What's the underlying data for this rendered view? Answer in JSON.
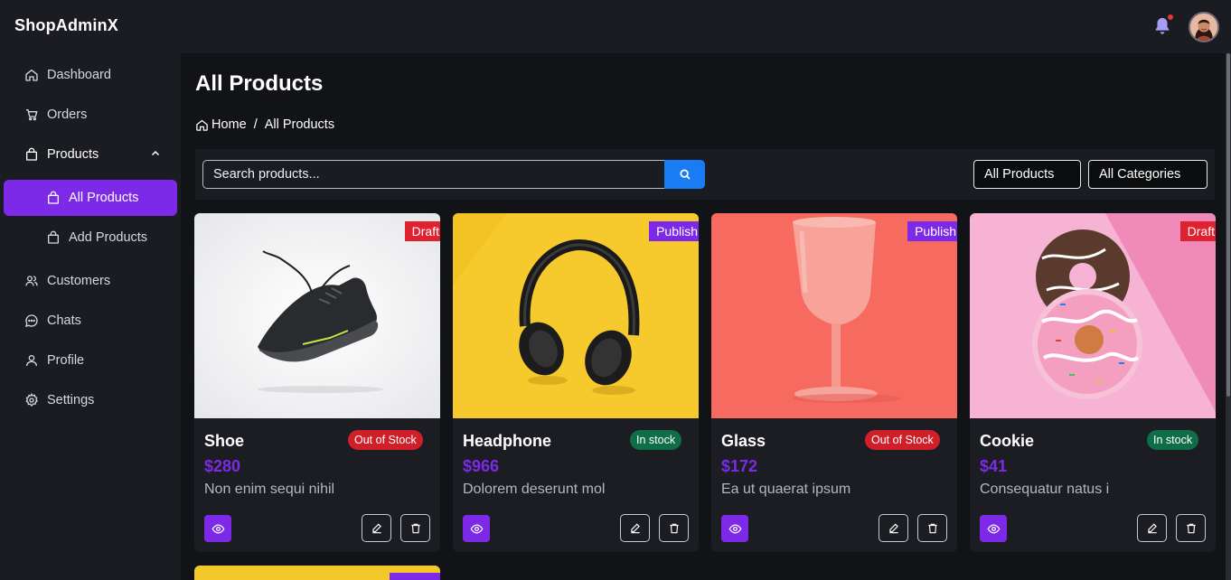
{
  "app": {
    "brand": "ShopAdminX"
  },
  "sidebar": {
    "items": [
      {
        "label": "Dashboard",
        "icon": "home-icon"
      },
      {
        "label": "Orders",
        "icon": "cart-icon"
      },
      {
        "label": "Products",
        "icon": "bag-icon",
        "expanded": true
      },
      {
        "label": "All Products",
        "icon": "bag-icon",
        "active": true
      },
      {
        "label": "Add Products",
        "icon": "bag-icon"
      },
      {
        "label": "Customers",
        "icon": "users-icon"
      },
      {
        "label": "Chats",
        "icon": "chat-icon"
      },
      {
        "label": "Profile",
        "icon": "user-icon"
      },
      {
        "label": "Settings",
        "icon": "gear-icon"
      }
    ]
  },
  "page": {
    "title": "All Products",
    "breadcrumb": {
      "home": "Home",
      "separator": "/",
      "current": "All Products"
    }
  },
  "toolbar": {
    "search_placeholder": "Search products...",
    "filter_status": "All Products",
    "filter_category": "All Categories"
  },
  "products": [
    {
      "name": "Shoe",
      "status": "Draft",
      "stock": "Out of Stock",
      "price": "$280",
      "desc": "Non enim sequi nihil"
    },
    {
      "name": "Headphone",
      "status": "Publish",
      "stock": "In stock",
      "price": "$966",
      "desc": "Dolorem deserunt mol"
    },
    {
      "name": "Glass",
      "status": "Publish",
      "stock": "Out of Stock",
      "price": "$172",
      "desc": "Ea ut quaerat ipsum"
    },
    {
      "name": "Cookie",
      "status": "Draft",
      "stock": "In stock",
      "price": "$41",
      "desc": "Consequatur natus i"
    }
  ],
  "colors": {
    "accent": "#7c2ae8",
    "draft": "#e0212f",
    "out_of_stock": "#d11f2a",
    "in_stock": "#0f6e47",
    "search_button": "#1a7cf5"
  }
}
